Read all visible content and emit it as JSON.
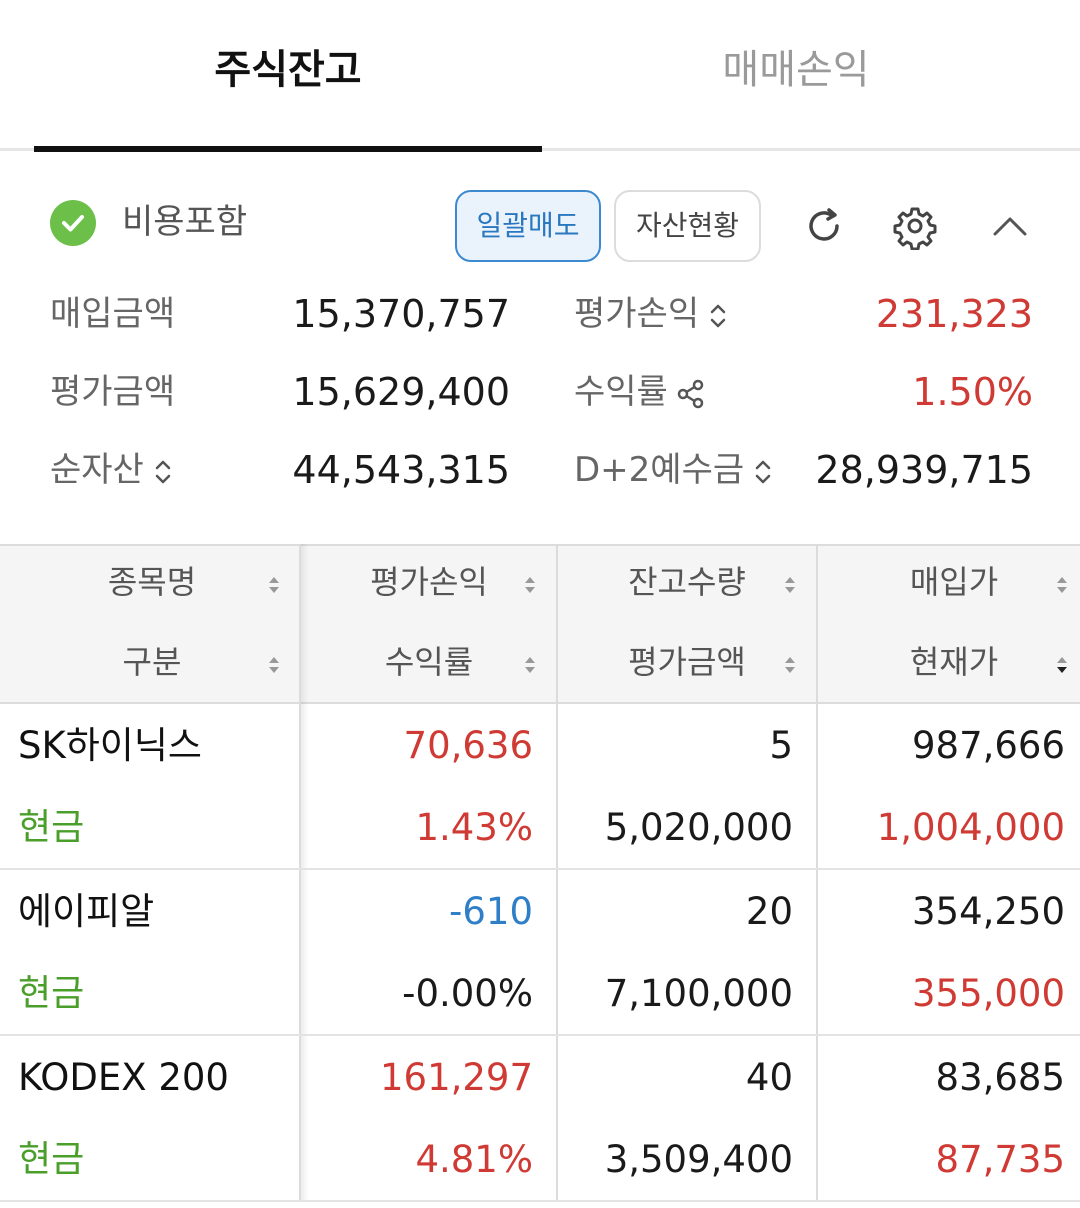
{
  "tabs": {
    "active": "주식잔고",
    "inactive": "매매손익"
  },
  "toolbar": {
    "include_cost": "비용포함",
    "bulk_sell": "일괄매도",
    "assets": "자산현황"
  },
  "summary": {
    "purchase_amount_label": "매입금액",
    "purchase_amount": "15,370,757",
    "eval_profit_label": "평가손익",
    "eval_profit": "231,323",
    "eval_amount_label": "평가금액",
    "eval_amount": "15,629,400",
    "return_label": "수익률",
    "return_rate": "1.50%",
    "net_assets_label": "순자산",
    "net_assets": "44,543,315",
    "deposit_label": "D+2예수금",
    "deposit": "28,939,715"
  },
  "table": {
    "headers": {
      "col1_top": "종목명",
      "col1_bottom": "구분",
      "col2_top": "평가손익",
      "col2_bottom": "수익률",
      "col3_top": "잔고수량",
      "col3_bottom": "평가금액",
      "col4_top": "매입가",
      "col4_bottom": "현재가"
    },
    "rows": [
      {
        "name": "SK하이닉스",
        "type": "현금",
        "profit": "70,636",
        "rate": "1.43%",
        "qty": "5",
        "eval": "5,020,000",
        "buy_price": "987,666",
        "cur_price": "1,004,000"
      },
      {
        "name": "에이피알",
        "type": "현금",
        "profit": "-610",
        "rate": "-0.00%",
        "qty": "20",
        "eval": "7,100,000",
        "buy_price": "354,250",
        "cur_price": "355,000"
      },
      {
        "name": "KODEX 200",
        "type": "현금",
        "profit": "161,297",
        "rate": "4.81%",
        "qty": "40",
        "eval": "3,509,400",
        "buy_price": "83,685",
        "cur_price": "87,735"
      }
    ]
  },
  "colors": {
    "up": "#d03a34",
    "down": "#2f7fc8",
    "type": "#4a9e2a",
    "accent": "#3b8ad0"
  }
}
